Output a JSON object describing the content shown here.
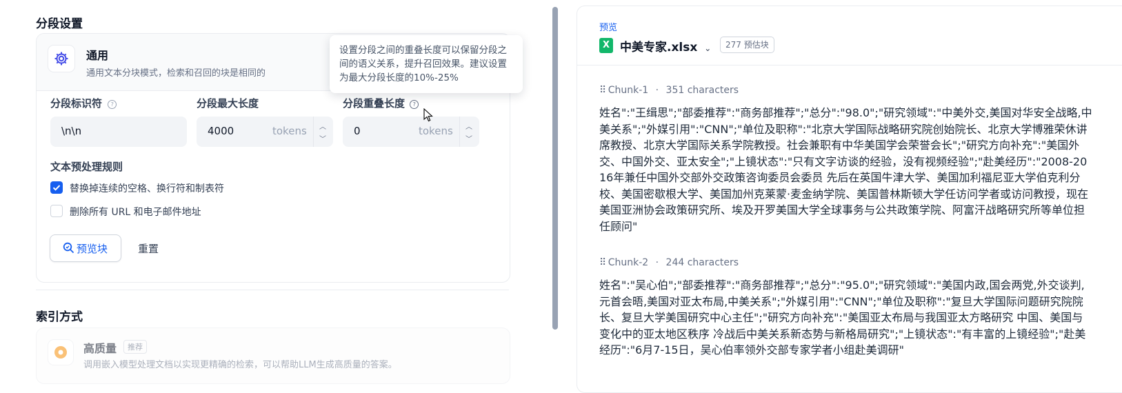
{
  "segment": {
    "title": "分段设置",
    "mode": {
      "title": "通用",
      "desc": "通用文本分块模式，检索和召回的块是相同的"
    },
    "delimiter": {
      "label": "分段标识符",
      "value": "\\n\\n"
    },
    "max_length": {
      "label": "分段最大长度",
      "value": "4000",
      "unit": "tokens"
    },
    "overlap": {
      "label": "分段重叠长度",
      "value": "0",
      "unit": "tokens"
    },
    "tooltip": "设置分段之间的重叠长度可以保留分段之间的语义关系，提升召回效果。建议设置为最大分段长度的10%-25%",
    "preprocess": {
      "title": "文本预处理规则",
      "rules": [
        {
          "label": "替换掉连续的空格、换行符和制表符",
          "checked": true
        },
        {
          "label": "删除所有 URL 和电子邮件地址",
          "checked": false
        }
      ]
    },
    "preview_button": "预览块",
    "reset_button": "重置"
  },
  "index": {
    "title": "索引方式",
    "high_quality": {
      "title": "高质量",
      "badge": "推荐",
      "desc": "调用嵌入模型处理文档以实现更精确的检索，可以帮助LLM生成高质量的答案。"
    }
  },
  "preview": {
    "tag": "预览",
    "file_name": "中美专家.xlsx",
    "estimate": "277 预估块",
    "chunks": [
      {
        "label": "Chunk-1",
        "chars": "351 characters",
        "text": "姓名\":\"王缉思\";\"部委推荐\":\"商务部推荐\";\"总分\":\"98.0\";\"研究领域\":\"中美外交,美国对华安全战略,中美关系\";\"外媒引用\":\"CNN\";\"单位及职称\":\"北京大学国际战略研究院创始院长、北京大学博雅荣休讲席教授、北京大学国际关系学院教授。社会兼职有中华美国学会荣誉会长\";\"研究方向补充\":\"美国外交、中国外交、亚太安全\";\"上镜状态\":\"只有文字访谈的经验，没有视频经验\";\"赴美经历\":\"2008-2016年兼任中国外交部外交政策咨询委员会委员 先后在英国牛津大学、美国加利福尼亚大学伯克利分校、美国密歇根大学、美国加州克莱蒙·麦金纳学院、美国普林斯顿大学任访问学者或访问教授，现在美国亚洲协会政策研究所、埃及开罗美国大学全球事务与公共政策学院、阿富汗战略研究所等单位担任顾问\""
      },
      {
        "label": "Chunk-2",
        "chars": "244 characters",
        "text": "姓名\":\"吴心伯\";\"部委推荐\":\"商务部推荐\";\"总分\":\"95.0\";\"研究领域\":\"美国内政,国会两党,外交谈判,元首会晤,美国对亚太布局,中美关系\";\"外媒引用\":\"CNN\";\"单位及职称\":\"复旦大学国际问题研究院院长、复旦大学美国研究中心主任\";\"研究方向补充\":\"美国亚太布局与我国亚太方略研究 中国、美国与变化中的亚太地区秩序 冷战后中美关系新态势与新格局研究\";\"上镜状态\":\"有丰富的上镜经验\";\"赴美经历\":\"6月7-15日，吴心伯率领外交部专家学者小组赴美调研\""
      }
    ]
  }
}
